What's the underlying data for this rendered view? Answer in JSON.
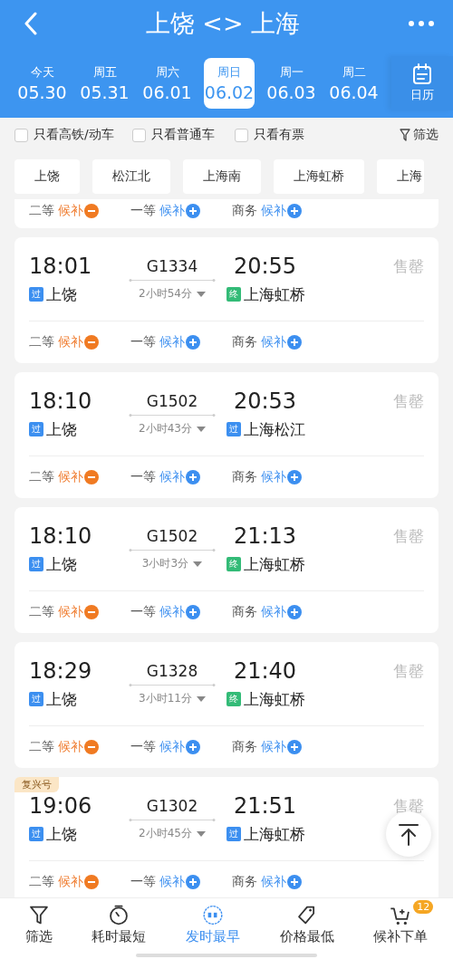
{
  "header": {
    "title": "上饶 <> 上海"
  },
  "dates": [
    {
      "weekday": "今天",
      "date": "05.30",
      "selected": false
    },
    {
      "weekday": "周五",
      "date": "05.31",
      "selected": false
    },
    {
      "weekday": "周六",
      "date": "06.01",
      "selected": false
    },
    {
      "weekday": "周日",
      "date": "06.02",
      "selected": true
    },
    {
      "weekday": "周一",
      "date": "06.03",
      "selected": false
    },
    {
      "weekday": "周二",
      "date": "06.04",
      "selected": false
    }
  ],
  "calendar_button": {
    "label": "日历"
  },
  "filters": [
    {
      "label": "只看高铁/动车",
      "checked": false
    },
    {
      "label": "只看普通车",
      "checked": false
    },
    {
      "label": "只看有票",
      "checked": false
    }
  ],
  "filter_button": {
    "label": "筛选"
  },
  "stations": [
    "上饶",
    "松江北",
    "上海南",
    "上海虹桥",
    "上海"
  ],
  "partial_card": {
    "seats": [
      {
        "class": "二等",
        "status": "候补",
        "kind": "minus"
      },
      {
        "class": "一等",
        "status": "候补",
        "kind": "plus"
      },
      {
        "class": "商务",
        "status": "候补",
        "kind": "plus"
      }
    ]
  },
  "trains": [
    {
      "depart": "18:01",
      "code": "G1334",
      "arrive": "20:55",
      "from": {
        "name": "上饶",
        "tag": "过",
        "color": "#3c8ff0"
      },
      "duration": "2小时54分",
      "to": {
        "name": "上海虹桥",
        "tag": "终",
        "color": "#33bb77"
      },
      "status": "售罄",
      "seats": [
        {
          "class": "二等",
          "status": "候补",
          "kind": "minus"
        },
        {
          "class": "一等",
          "status": "候补",
          "kind": "plus"
        },
        {
          "class": "商务",
          "status": "候补",
          "kind": "plus"
        }
      ]
    },
    {
      "depart": "18:10",
      "code": "G1502",
      "arrive": "20:53",
      "from": {
        "name": "上饶",
        "tag": "过",
        "color": "#3c8ff0"
      },
      "duration": "2小时43分",
      "to": {
        "name": "上海松江",
        "tag": "过",
        "color": "#3c8ff0"
      },
      "status": "售罄",
      "seats": [
        {
          "class": "二等",
          "status": "候补",
          "kind": "minus"
        },
        {
          "class": "一等",
          "status": "候补",
          "kind": "plus"
        },
        {
          "class": "商务",
          "status": "候补",
          "kind": "plus"
        }
      ]
    },
    {
      "depart": "18:10",
      "code": "G1502",
      "arrive": "21:13",
      "from": {
        "name": "上饶",
        "tag": "过",
        "color": "#3c8ff0"
      },
      "duration": "3小时3分",
      "to": {
        "name": "上海虹桥",
        "tag": "终",
        "color": "#33bb77"
      },
      "status": "售罄",
      "seats": [
        {
          "class": "二等",
          "status": "候补",
          "kind": "minus"
        },
        {
          "class": "一等",
          "status": "候补",
          "kind": "plus"
        },
        {
          "class": "商务",
          "status": "候补",
          "kind": "plus"
        }
      ]
    },
    {
      "depart": "18:29",
      "code": "G1328",
      "arrive": "21:40",
      "from": {
        "name": "上饶",
        "tag": "过",
        "color": "#3c8ff0"
      },
      "duration": "3小时11分",
      "to": {
        "name": "上海虹桥",
        "tag": "终",
        "color": "#33bb77"
      },
      "status": "售罄",
      "seats": [
        {
          "class": "二等",
          "status": "候补",
          "kind": "minus"
        },
        {
          "class": "一等",
          "status": "候补",
          "kind": "plus"
        },
        {
          "class": "商务",
          "status": "候补",
          "kind": "plus"
        }
      ]
    },
    {
      "tag": "复兴号",
      "depart": "19:06",
      "code": "G1302",
      "arrive": "21:51",
      "from": {
        "name": "上饶",
        "tag": "过",
        "color": "#3c8ff0"
      },
      "duration": "2小时45分",
      "to": {
        "name": "上海虹桥",
        "tag": "过",
        "color": "#3c8ff0"
      },
      "status": "售罄",
      "seats": [
        {
          "class": "二等",
          "status": "候补",
          "kind": "minus"
        },
        {
          "class": "一等",
          "status": "候补",
          "kind": "plus"
        },
        {
          "class": "商务",
          "status": "候补",
          "kind": "plus"
        }
      ]
    }
  ],
  "bottom_nav": [
    {
      "label": "筛选",
      "selected": false
    },
    {
      "label": "耗时最短",
      "selected": false
    },
    {
      "label": "发时最早",
      "selected": true
    },
    {
      "label": "价格最低",
      "selected": false
    },
    {
      "label": "候补下单",
      "selected": false,
      "badge": "12"
    }
  ]
}
